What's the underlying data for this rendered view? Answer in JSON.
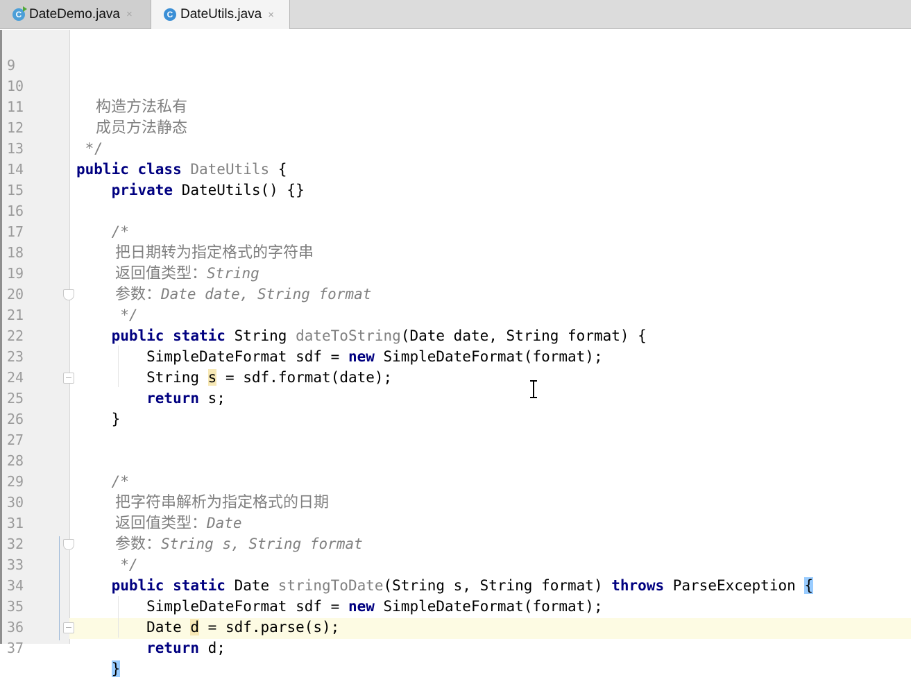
{
  "tabs": [
    {
      "label": "DateDemo.java",
      "icon": "java-class-run-icon",
      "active": false,
      "close": "×"
    },
    {
      "label": "DateUtils.java",
      "icon": "java-class-icon",
      "active": true,
      "close": "×"
    }
  ],
  "editor": {
    "lines": [
      {
        "n": "9"
      },
      {
        "n": "10",
        "t1": "    构造方法私有"
      },
      {
        "n": "11",
        "t1": "    成员方法静态"
      },
      {
        "n": "12",
        "t1": " */"
      },
      {
        "n": "13",
        "kw1": "public class ",
        "t2": "DateUtils",
        "t3": " {"
      },
      {
        "n": "14",
        "kw1": "    private ",
        "t2": "DateUtils() {}"
      },
      {
        "n": "15"
      },
      {
        "n": "16",
        "t1": "    /*"
      },
      {
        "n": "17",
        "t1": "        把日期转为指定格式的字符串"
      },
      {
        "n": "18",
        "t1": "        返回值类型：",
        "t2": "String"
      },
      {
        "n": "19",
        "t1": "        参数：",
        "t2": "Date date, String format"
      },
      {
        "n": "20",
        "t1": "     */"
      },
      {
        "n": "21",
        "kw1": "    public static ",
        "t2": "String ",
        "t3": "dateToString",
        "t4": "(Date date, String format) {"
      },
      {
        "n": "22",
        "t1": "        SimpleDateFormat sdf = ",
        "kw2": "new",
        "t3": " SimpleDateFormat(format);"
      },
      {
        "n": "23",
        "t1": "        String ",
        "hl": "s",
        "t3": " = sdf.format(date);"
      },
      {
        "n": "24",
        "kw1": "        return",
        "t2": " s;"
      },
      {
        "n": "25",
        "t1": "    }"
      },
      {
        "n": "26"
      },
      {
        "n": "27"
      },
      {
        "n": "28",
        "t1": "    /*"
      },
      {
        "n": "29",
        "t1": "        把字符串解析为指定格式的日期"
      },
      {
        "n": "30",
        "t1": "        返回值类型：",
        "t2": "Date"
      },
      {
        "n": "31",
        "t1": "        参数：",
        "t2": "String s, String format"
      },
      {
        "n": "32",
        "t1": "     */"
      },
      {
        "n": "33",
        "kw1": "    public static ",
        "t2": "Date ",
        "t3": "stringToDate",
        "t4": "(String s, String format) ",
        "kw5": "throws",
        "t6": " ParseException ",
        "hl": "{"
      },
      {
        "n": "34",
        "t1": "        SimpleDateFormat sdf = ",
        "kw2": "new",
        "t3": " SimpleDateFormat(format);"
      },
      {
        "n": "35",
        "t1": "        Date ",
        "hl": "d",
        "t3": " = sdf.parse(s);"
      },
      {
        "n": "36",
        "kw1": "        return",
        "t2": " d;"
      },
      {
        "n": "37",
        "t1": "    ",
        "hl": "}"
      }
    ]
  },
  "colors": {
    "keyword": "#000080",
    "comment": "#808080",
    "current_line": "#fdfbe3",
    "brace_match": "#99ccff",
    "identifier_highlight": "#f7e8b5"
  }
}
